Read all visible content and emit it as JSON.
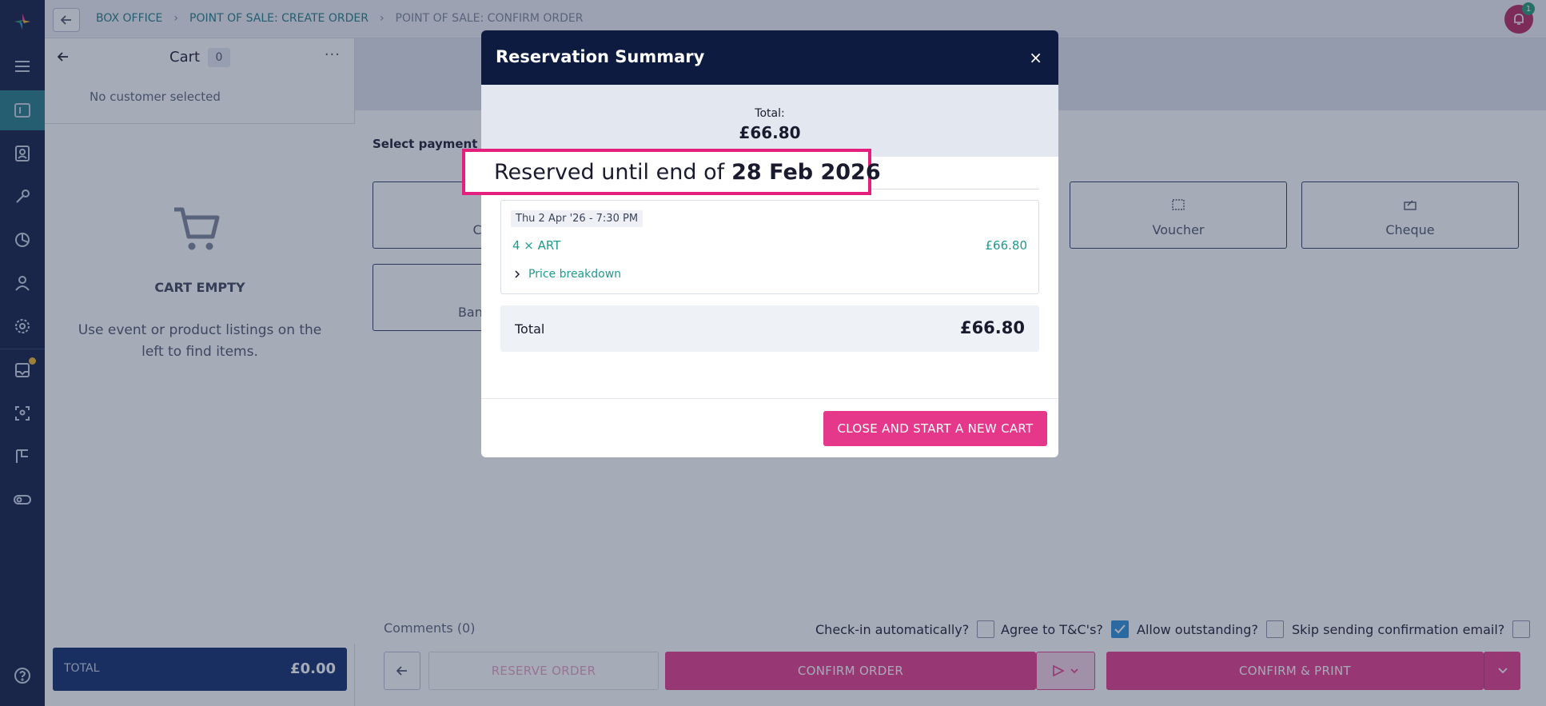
{
  "breadcrumbs": [
    "BOX OFFICE",
    "POINT OF SALE: CREATE ORDER",
    "POINT OF SALE: CONFIRM ORDER"
  ],
  "notification_count": "1",
  "cart": {
    "title": "Cart",
    "count": "0",
    "more": "···",
    "customer": "No customer selected",
    "empty_title": "CART EMPTY",
    "empty_desc": "Use event or product listings on the left to find items.",
    "total_label": "TOTAL",
    "total_value": "£0.00"
  },
  "payment": {
    "label": "Select payment m",
    "tiles": [
      "Ca",
      "Voucher",
      "Cheque",
      "Bank tr"
    ]
  },
  "options": {
    "comments": "Comments (0)",
    "checkin": "Check-in automatically?",
    "agree": "Agree to T&C's?",
    "outstanding": "Allow outstanding?",
    "skip_email": "Skip sending confirmation email?"
  },
  "actions": {
    "reserve": "RESERVE ORDER",
    "confirm": "CONFIRM ORDER",
    "confirm_print": "CONFIRM & PRINT"
  },
  "modal": {
    "title": "Reservation Summary",
    "close": "×",
    "total_label": "Total:",
    "total_value": "£66.80",
    "reserved_prefix": "Reserved until end of",
    "reserved_date": "28 Feb 2026",
    "item_date": "Thu 2 Apr '26 - 7:30 PM",
    "item_name": "4 × ART",
    "item_price": "£66.80",
    "breakdown": "Price breakdown",
    "total_row_label": "Total",
    "total_row_value": "£66.80",
    "new_cart": "CLOSE AND START A NEW CART"
  },
  "colors": {
    "rail": "#0d1b40",
    "accent_pink": "#e6388a",
    "teal": "#1f7a84",
    "modal_header": "#0d1b40"
  }
}
